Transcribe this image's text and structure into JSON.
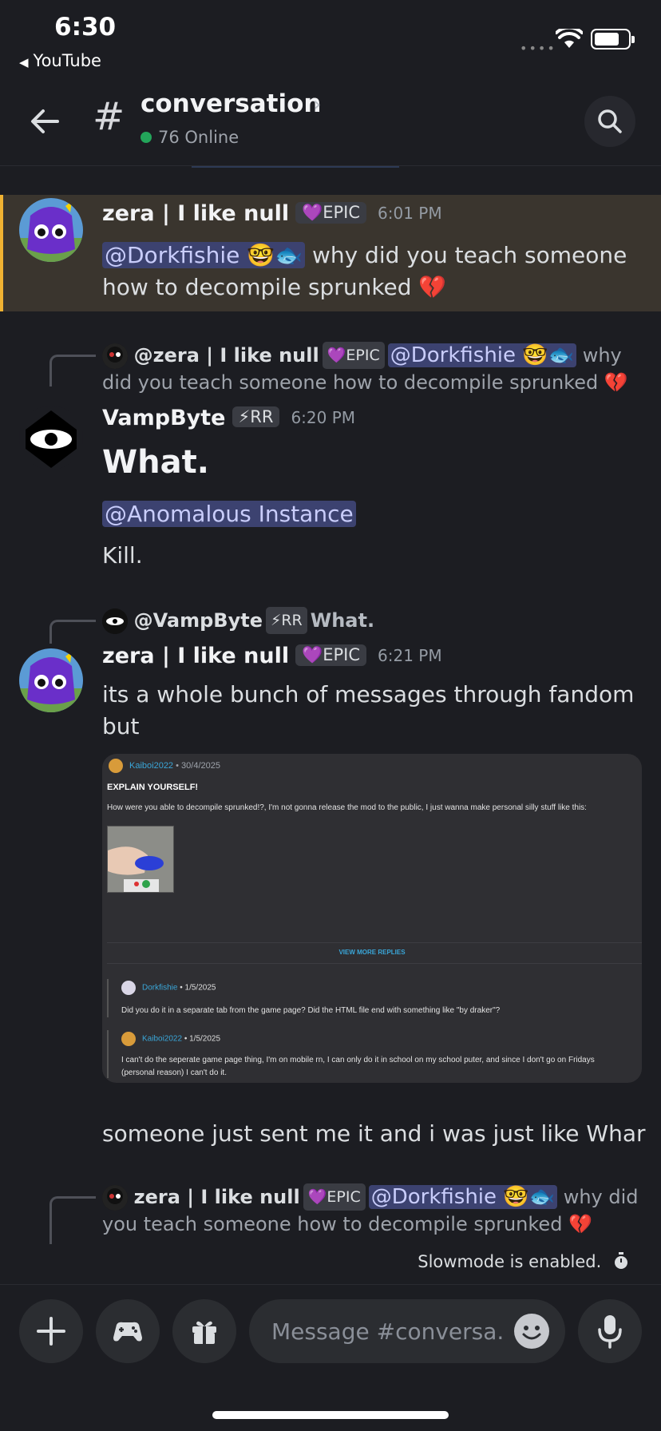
{
  "status_bar": {
    "time": "6:30",
    "back_app": "YouTube"
  },
  "header": {
    "channel_name": "conversation",
    "online_count": "76 Online"
  },
  "messages": [
    {
      "author": "zera | I like null",
      "badge": "EPIC",
      "time": "6:01 PM",
      "mention": "@Dorkfishie 🤓🐟",
      "text_after_mention": "why did you teach someone",
      "text_line2": "how to decompile sprunked 💔"
    },
    {
      "reply_author": "@zera | I like null",
      "reply_badge": "EPIC",
      "reply_mention": "@Dorkfishie 🤓🐟",
      "reply_text": "why",
      "reply_text2": "did you teach someone how to decompile sprunked 💔",
      "author": "VampByte",
      "badge": "⚡RR",
      "time": "6:20 PM",
      "heading": "What.",
      "mention": "@Anomalous Instance",
      "text": "Kill."
    },
    {
      "reply_author": "@VampByte",
      "reply_badge": "⚡RR",
      "reply_text": "What.",
      "author": "zera | I like null",
      "badge": "EPIC",
      "time": "6:21 PM",
      "text": "its a whole bunch of messages through fandom",
      "text_line2": "but",
      "text_after_embed": "someone just sent me it and i was just like Whar"
    },
    {
      "reply_author": "zera | I like null",
      "reply_badge": "EPIC",
      "reply_mention": "@Dorkfishie 🤓🐟",
      "reply_text": "why did",
      "reply_text2": "you teach someone how to decompile sprunked 💔"
    }
  ],
  "embed": {
    "post_author": "Kaiboi2022",
    "post_date": "• 30/4/2025",
    "post_title": "EXPLAIN YOURSELF!",
    "post_body": "How were you able to decompile sprunked!?, I'm not gonna release the mod to the public, I just wanna make personal silly stuff like this:",
    "view_more": "VIEW MORE REPLIES",
    "reply1_author": "Dorkfishie",
    "reply1_date": "• 1/5/2025",
    "reply1_text": "Did you do it in a separate tab from the game page? Did the HTML file end with something like \"by draker\"?",
    "reply2_author": "Kaiboi2022",
    "reply2_date": "• 1/5/2025",
    "reply2_text": "I can't do the seperate game page thing, I'm on mobile rn, I can only do it in school on my school puter, and since I don't go on Fridays",
    "reply2_text2": "(personal reason) I can't do it."
  },
  "slowmode": "Slowmode is enabled.",
  "composer": {
    "placeholder": "Message #conversa..."
  },
  "colors": {
    "background": "#1c1d22",
    "highlight": "#3a352e",
    "highlight_border": "#f0b232",
    "mention_bg": "#3c4270",
    "online": "#23a55a"
  }
}
